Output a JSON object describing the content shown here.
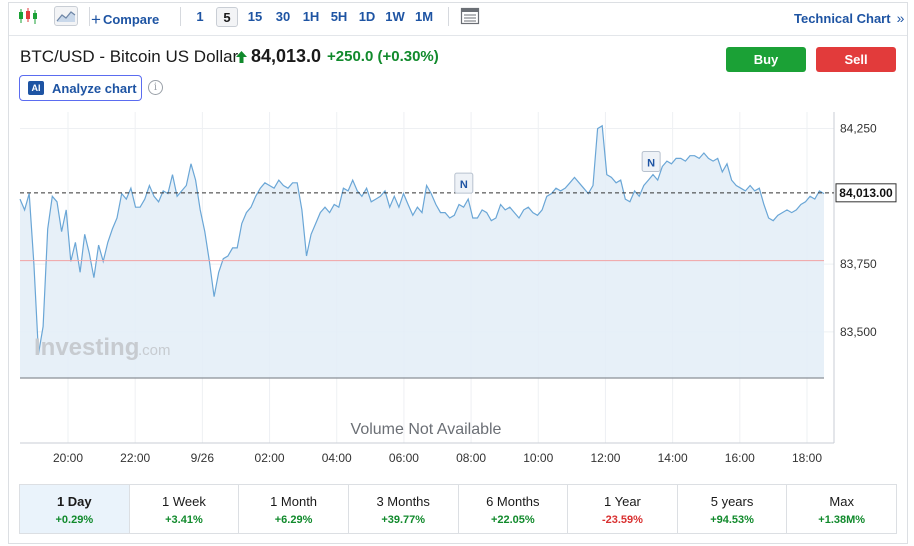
{
  "toolbar": {
    "compare_label": "Compare",
    "timeframes": [
      "1",
      "5",
      "15",
      "30",
      "1H",
      "5H",
      "1D",
      "1W",
      "1M"
    ],
    "active_timeframe": "5",
    "technical_chart_label": "Technical Chart",
    "technical_chart_arrow": "»"
  },
  "header": {
    "symbol": "BTC/USD - Bitcoin US Dollar",
    "price": "84,013.0",
    "change": "+250.0",
    "change_pct": "(+0.30%)",
    "buy_label": "Buy",
    "sell_label": "Sell",
    "analyze_badge": "AI",
    "analyze_label": "Analyze chart",
    "info_symbol": "i"
  },
  "colors": {
    "accent_blue": "#1e54a3",
    "positive": "#118a2c",
    "negative": "#d93030",
    "buy": "#1ba136",
    "sell": "#e23b3b",
    "series_line": "#6aa6d6",
    "series_fill": "#e3edf7"
  },
  "chart_data": {
    "type": "area",
    "y_ticks": [
      "84,250",
      "83,750",
      "83,500"
    ],
    "x_ticks": [
      "20:00",
      "22:00",
      "9/26",
      "02:00",
      "04:00",
      "06:00",
      "08:00",
      "10:00",
      "12:00",
      "14:00",
      "16:00",
      "18:00"
    ],
    "ylim": [
      83330,
      84300
    ],
    "current_price_label": "84,013.00",
    "current_price": 84013,
    "prev_close_line": 83763,
    "news_markers": [
      {
        "label": "N",
        "time_index": 0.552,
        "value": 84045
      },
      {
        "label": "N",
        "time_index": 0.785,
        "value": 84125
      }
    ],
    "series": [
      {
        "values": [
          83990,
          83950,
          84010,
          83750,
          83420,
          83520,
          83880,
          84000,
          83980,
          83870,
          83950,
          83760,
          83830,
          83720,
          83860,
          83790,
          83700,
          83820,
          83760,
          83830,
          83880,
          83920,
          84010,
          83990,
          84030,
          83960,
          83960,
          83990,
          84040,
          84000,
          83980,
          84020,
          84010,
          84080,
          84000,
          84020,
          84040,
          84120,
          84060,
          83950,
          83870,
          83760,
          83630,
          83720,
          83770,
          83780,
          83810,
          83810,
          83900,
          83940,
          83960,
          84000,
          84030,
          84050,
          84040,
          84030,
          84060,
          84040,
          84030,
          84050,
          84050,
          83950,
          83780,
          83860,
          83900,
          83940,
          83960,
          83940,
          83970,
          83960,
          84030,
          84020,
          84060,
          84020,
          84000,
          84030,
          83980,
          83990,
          84000,
          84020,
          83960,
          84000,
          83960,
          84010,
          83970,
          83930,
          83960,
          83940,
          84040,
          84010,
          83970,
          83940,
          83940,
          83920,
          83930,
          83970,
          83960,
          83990,
          83920,
          83920,
          83950,
          83940,
          83910,
          83920,
          83970,
          83950,
          83960,
          83940,
          83920,
          83950,
          83960,
          83940,
          83930,
          83950,
          84000,
          84010,
          84030,
          84020,
          84030,
          84050,
          84070,
          84050,
          84030,
          84010,
          84040,
          84250,
          84260,
          84080,
          84070,
          84050,
          84060,
          83990,
          83980,
          84020,
          84000,
          84040,
          84060,
          84080,
          84060,
          84110,
          84130,
          84120,
          84140,
          84140,
          84130,
          84150,
          84150,
          84140,
          84160,
          84140,
          84130,
          84140,
          84090,
          84120,
          84060,
          84040,
          84030,
          84020,
          84040,
          84020,
          84030,
          83970,
          83920,
          83910,
          83930,
          83940,
          83950,
          83940,
          83950,
          83970,
          83980,
          84000,
          83990,
          84020,
          84010
        ]
      }
    ],
    "volume_text": "Volume Not Available",
    "watermark_brand": "Investing",
    "watermark_suffix": ".com",
    "grid": true
  },
  "periods": [
    {
      "label": "1 Day",
      "value": "+0.29%",
      "active": true
    },
    {
      "label": "1 Week",
      "value": "+3.41%"
    },
    {
      "label": "1 Month",
      "value": "+6.29%"
    },
    {
      "label": "3 Months",
      "value": "+39.77%"
    },
    {
      "label": "6 Months",
      "value": "+22.05%"
    },
    {
      "label": "1 Year",
      "value": "-23.59%"
    },
    {
      "label": "5 years",
      "value": "+94.53%"
    },
    {
      "label": "Max",
      "value": "+1.38M%"
    }
  ]
}
